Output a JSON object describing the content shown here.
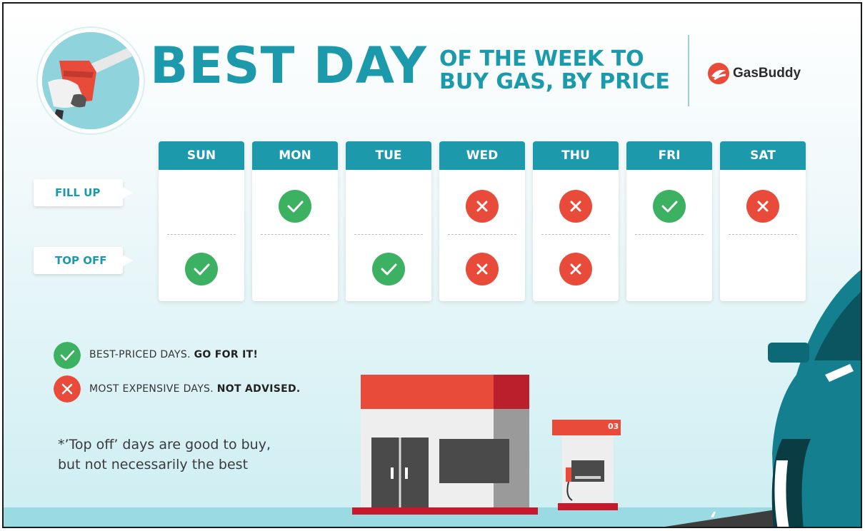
{
  "header": {
    "title_big": "BEST DAY",
    "title_small_line1": "OF THE WEEK TO",
    "title_small_line2": "BUY GAS, BY PRICE",
    "brand": "GasBuddy"
  },
  "rows": {
    "fill_up": "FILL UP",
    "top_off": "TOP OFF"
  },
  "days": [
    {
      "label": "SUN",
      "fill_up": "none",
      "top_off": "good"
    },
    {
      "label": "MON",
      "fill_up": "good",
      "top_off": "none"
    },
    {
      "label": "TUE",
      "fill_up": "none",
      "top_off": "good"
    },
    {
      "label": "WED",
      "fill_up": "bad",
      "top_off": "bad"
    },
    {
      "label": "THU",
      "fill_up": "bad",
      "top_off": "bad"
    },
    {
      "label": "FRI",
      "fill_up": "good",
      "top_off": "none"
    },
    {
      "label": "SAT",
      "fill_up": "bad",
      "top_off": "none"
    }
  ],
  "legend": {
    "good_text": "BEST-PRICED DAYS.",
    "good_bold": "GO FOR IT!",
    "bad_text": "MOST EXPENSIVE DAYS.",
    "bad_bold": "NOT ADVISED."
  },
  "note": {
    "line1": "*’Top off’ days are good to buy,",
    "line2": "but not necessarily the best"
  },
  "pump_number": "03",
  "colors": {
    "teal": "#1c9aab",
    "good": "#3bb161",
    "bad": "#e94b3a"
  }
}
